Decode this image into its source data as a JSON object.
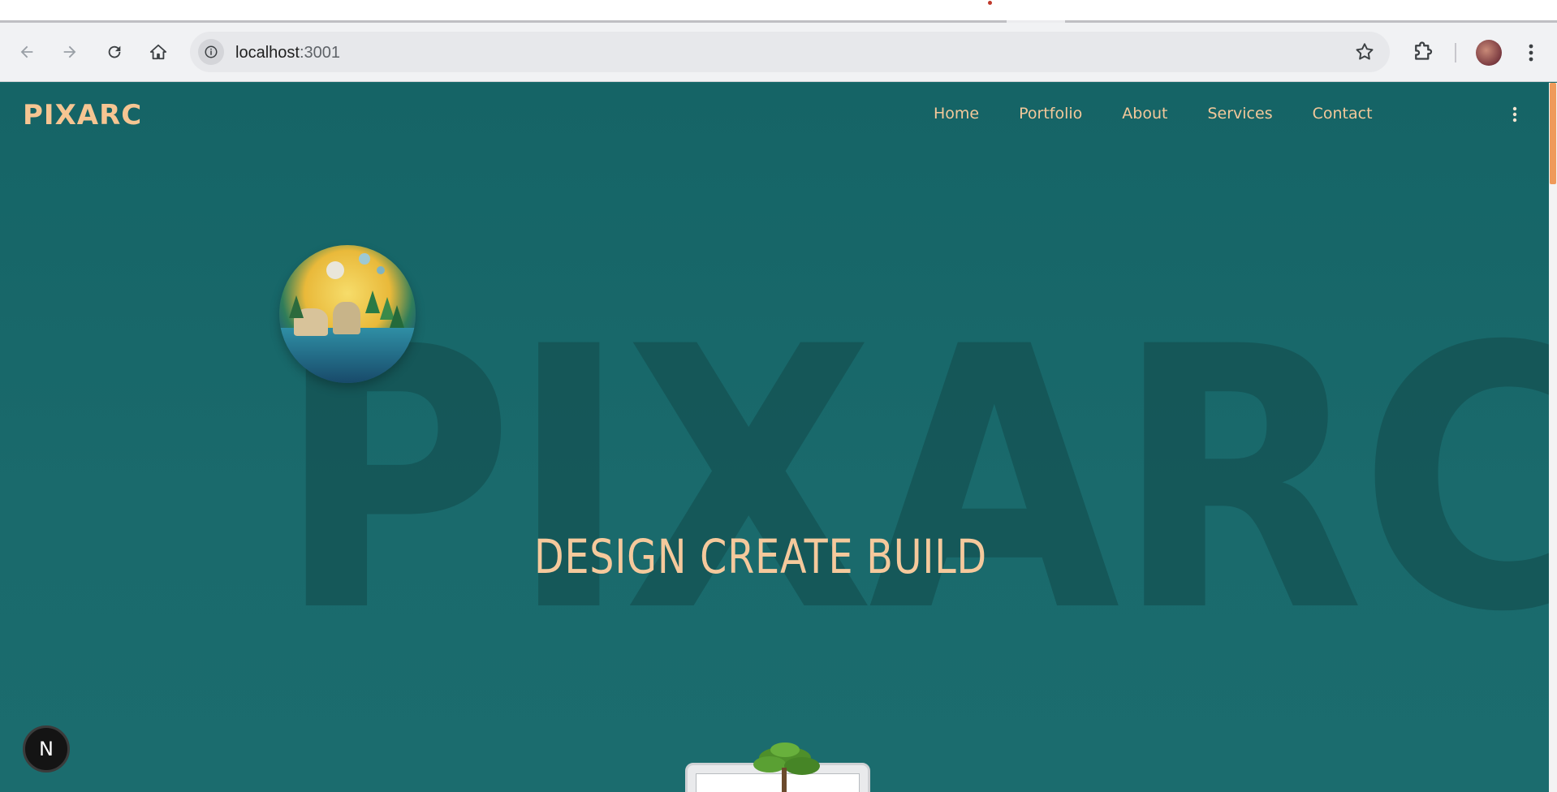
{
  "browser": {
    "url_host": "localhost",
    "url_port": ":3001"
  },
  "site": {
    "logo_text": "PIXARC",
    "nav": {
      "home": "Home",
      "portfolio": "Portfolio",
      "about": "About",
      "services": "Services",
      "contact": "Contact"
    },
    "hero": {
      "watermark": "PIXARC",
      "tagline": "DESIGN CREATE BUILD"
    }
  },
  "dev": {
    "badge_letter": "N"
  },
  "colors": {
    "background": "#1a6b6d",
    "accent": "#f5c99c",
    "scroll_thumb": "#ef9a5a"
  }
}
